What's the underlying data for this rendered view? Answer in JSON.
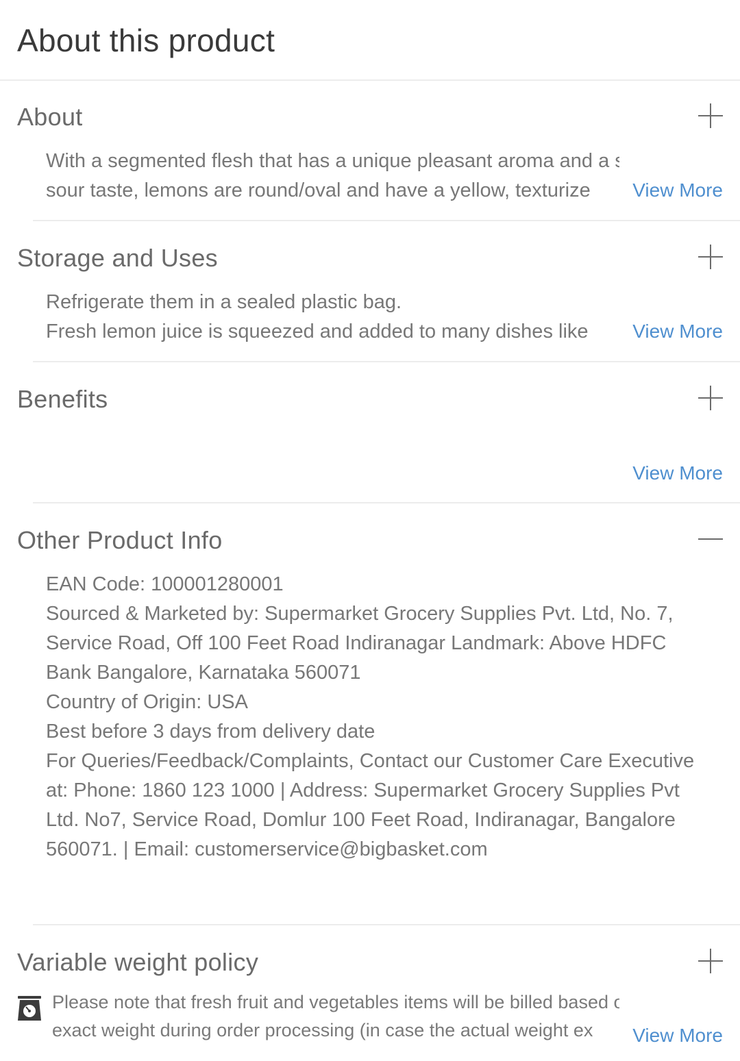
{
  "page": {
    "title": "About this product"
  },
  "sections": {
    "about": {
      "title": "About",
      "toggle_icon": "plus-icon",
      "text_line1": "With a segmented flesh that has a unique pleasant aroma and a strong",
      "text_line2": "sour taste, lemons are round/oval and have a yellow, texturize",
      "view_more": "View More"
    },
    "storage": {
      "title": "Storage and Uses",
      "toggle_icon": "plus-icon",
      "text_line1": "Refrigerate them in a sealed plastic bag.",
      "text_line2": "Fresh lemon juice is squeezed and added to many dishes like",
      "view_more": "View More"
    },
    "benefits": {
      "title": "Benefits",
      "toggle_icon": "plus-icon",
      "view_more": "View More"
    },
    "other_info": {
      "title": "Other Product Info",
      "toggle_icon": "minus-icon",
      "text": "EAN Code: 100001280001\nSourced & Marketed by: Supermarket Grocery Supplies Pvt. Ltd, No. 7, Service Road, Off 100 Feet Road Indiranagar Landmark: Above HDFC Bank Bangalore, Karnataka 560071\nCountry of Origin: USA\nBest before 3 days from delivery date\nFor Queries/Feedback/Complaints, Contact our Customer Care Executive at: Phone: 1860 123 1000 | Address: Supermarket Grocery Supplies Pvt Ltd. No7, Service Road, Domlur 100 Feet Road, Indiranagar, Bangalore 560071. | Email: customerservice@bigbasket.com"
    },
    "weight_policy": {
      "title": "Variable weight policy",
      "toggle_icon": "plus-icon",
      "icon": "weighing-scale-icon",
      "text_line1": "Please note that fresh fruit and vegetables items will be billed based on",
      "text_line2": "exact weight during order processing (in case the actual weight ex",
      "view_more": "View More"
    }
  },
  "colors": {
    "link": "#4f8fcf",
    "divider": "#ececec",
    "title": "#3a3a3a",
    "text": "#777777"
  }
}
